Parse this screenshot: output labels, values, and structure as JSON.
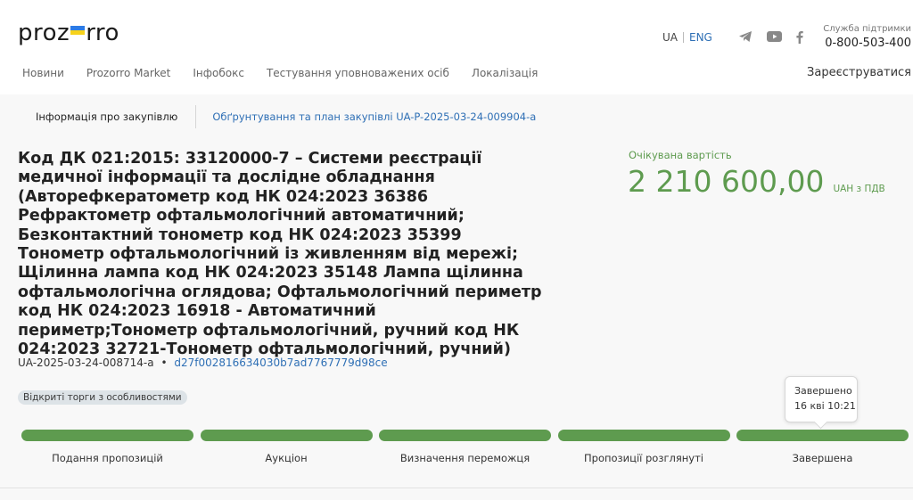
{
  "header": {
    "logo": {
      "left": "proz",
      "right": "rro"
    },
    "lang": {
      "ua": "UA",
      "eng": "ENG"
    },
    "support": {
      "label": "Служба підтримки",
      "phone": "0-800-503-400"
    },
    "nav": [
      "Новини",
      "Prozorro Market",
      "Інфобокс",
      "Тестування уповноважених осіб",
      "Локалізація"
    ],
    "register": "Зареєструватися",
    "icons": [
      "telegram-icon",
      "youtube-icon",
      "facebook-icon"
    ]
  },
  "tabs": {
    "active": "Інформація про закупівлю",
    "link": "Обґрунтування та план закупівлі UA-P-2025-03-24-009904-a"
  },
  "tender": {
    "title": "Код ДК 021:2015: 33120000-7 – Системи реєстрації медичної інформації та дослідне обладнання (Авторефкератометр код НК 024:2023 36386 Рефрактометр офтальмологічний автоматичний; Безконтактний тонометр код НК 024:2023 35399 Тонометр офтальмологічний із живленням від мережі; Щілинна лампа код НК 024:2023 35148 Лампа щілинна офтальмологічна оглядова; Офтальмологічний периметр код НК 024:2023 16918 - Автоматичний периметр;Тонометр офтальмологічний, ручний код НК 024:2023 32721-Тонометр офтальмологічний, ручний)",
    "id": "UA-2025-03-24-008714-a",
    "dot": "•",
    "hash": "d27f002816634030b7ad7767779d98ce",
    "badge": "Відкриті торги з особливостями"
  },
  "value": {
    "label": "Очікувана вартість",
    "amount": "2 210 600,00",
    "currency": "UAH з ПДВ"
  },
  "status": {
    "label": "Завершено",
    "date": "16 кві 10:21"
  },
  "stages": [
    "Подання пропозицій",
    "Аукціон",
    "Визначення переможця",
    "Пропозиції розглянуті",
    "Завершена"
  ],
  "colors": {
    "green": "#5e9b4f",
    "link": "#2e6fb5",
    "flagBlue": "#2c7be5",
    "flagYellow": "#f7d21b"
  }
}
